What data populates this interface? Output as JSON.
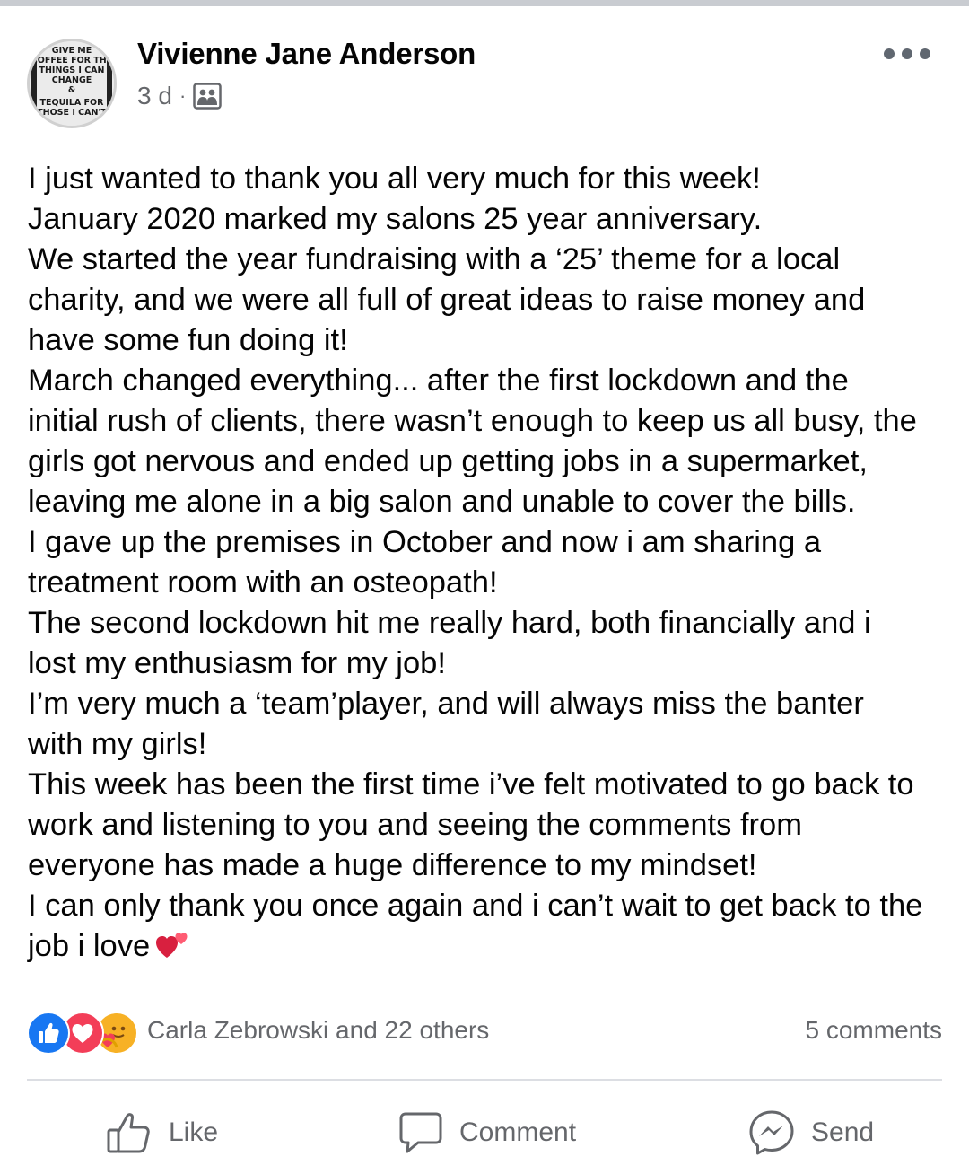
{
  "post": {
    "author": "Vivienne Jane Anderson",
    "time": "3 d",
    "separator": "·",
    "audience_icon": "group-audience-icon",
    "avatar": {
      "text_lines": [
        "GIVE ME",
        "COFFEE FOR THE",
        "THINGS I CAN",
        "CHANGE",
        "&",
        "TEQUILA FOR",
        "THOSE I CAN'T"
      ]
    },
    "body_lines": [
      "I just wanted to thank you all very much for this week!",
      "January 2020 marked my salons 25 year anniversary.",
      "We started the year fundraising with a ‘25’ theme for a local",
      "charity, and we were all full of great ideas to raise money and",
      "have some fun doing it!",
      "March changed everything... after the first lockdown and the",
      "initial rush of clients, there wasn’t enough to keep us all busy, the",
      "girls got nervous and ended up getting jobs in a supermarket,",
      "leaving me alone in a big salon and unable to cover the bills.",
      "I gave up the premises in October and now i am sharing a",
      "treatment room with an osteopath!",
      "The second lockdown hit me really hard, both financially and i",
      "lost my enthusiasm for my job!",
      "I’m very much a ‘team’player, and will always miss the banter",
      "with my girls!",
      "This week has been the first time i’ve felt motivated to go back to",
      "work and listening to you and seeing the comments from",
      "everyone has made a huge difference to my mindset!",
      "I can only thank you once again and i can’t wait to get back to the",
      "job i love"
    ],
    "end_emoji": "two-hearts-emoji"
  },
  "reactions": {
    "icons": [
      "like-reaction-icon",
      "love-reaction-icon",
      "care-reaction-icon"
    ],
    "names": "Carla Zebrowski and 22 others",
    "comments": "5 comments"
  },
  "actions": {
    "like_label": "Like",
    "comment_label": "Comment",
    "send_label": "Send"
  },
  "colors": {
    "like_blue": "#1877f2",
    "love_red": "#f33e58",
    "care_yellow": "#f7b125",
    "secondary_text": "#65676b"
  }
}
